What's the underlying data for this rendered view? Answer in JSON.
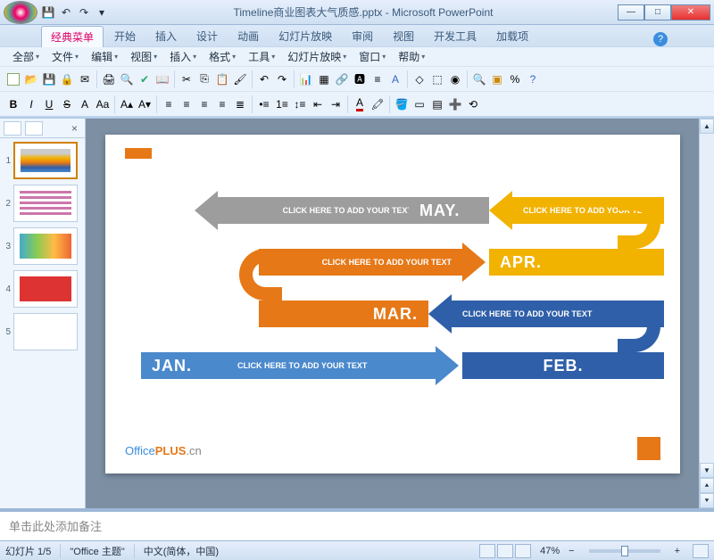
{
  "window": {
    "title_file": "Timeline商业图表大气质感.pptx",
    "title_app": "Microsoft PowerPoint"
  },
  "ribbon_tabs": [
    "经典菜单",
    "开始",
    "插入",
    "设计",
    "动画",
    "幻灯片放映",
    "审阅",
    "视图",
    "开发工具",
    "加载项"
  ],
  "active_tab_index": 0,
  "menubar": [
    "全部",
    "文件",
    "编辑",
    "视图",
    "插入",
    "格式",
    "工具",
    "幻灯片放映",
    "窗口",
    "帮助"
  ],
  "thumbs": [
    "1",
    "2",
    "3",
    "4",
    "5"
  ],
  "slide": {
    "placeholder": "CLICK HERE TO ADD YOUR TEXT",
    "months": {
      "jan": "JAN.",
      "feb": "FEB.",
      "mar": "MAR.",
      "apr": "APR.",
      "may": "MAY."
    },
    "logo": {
      "p1": "Office",
      "p2": "PLUS",
      "p3": ".cn"
    }
  },
  "notes": {
    "placeholder": "单击此处添加备注"
  },
  "status": {
    "slide_counter": "幻灯片 1/5",
    "theme": "\"Office 主题\"",
    "lang": "中文(简体，中国)",
    "zoom": "47%"
  },
  "colors": {
    "gray": "#9d9d9d",
    "yellow": "#f2b200",
    "orange": "#e67817",
    "darkblue": "#2f5fa8",
    "blue": "#4a89cc"
  }
}
